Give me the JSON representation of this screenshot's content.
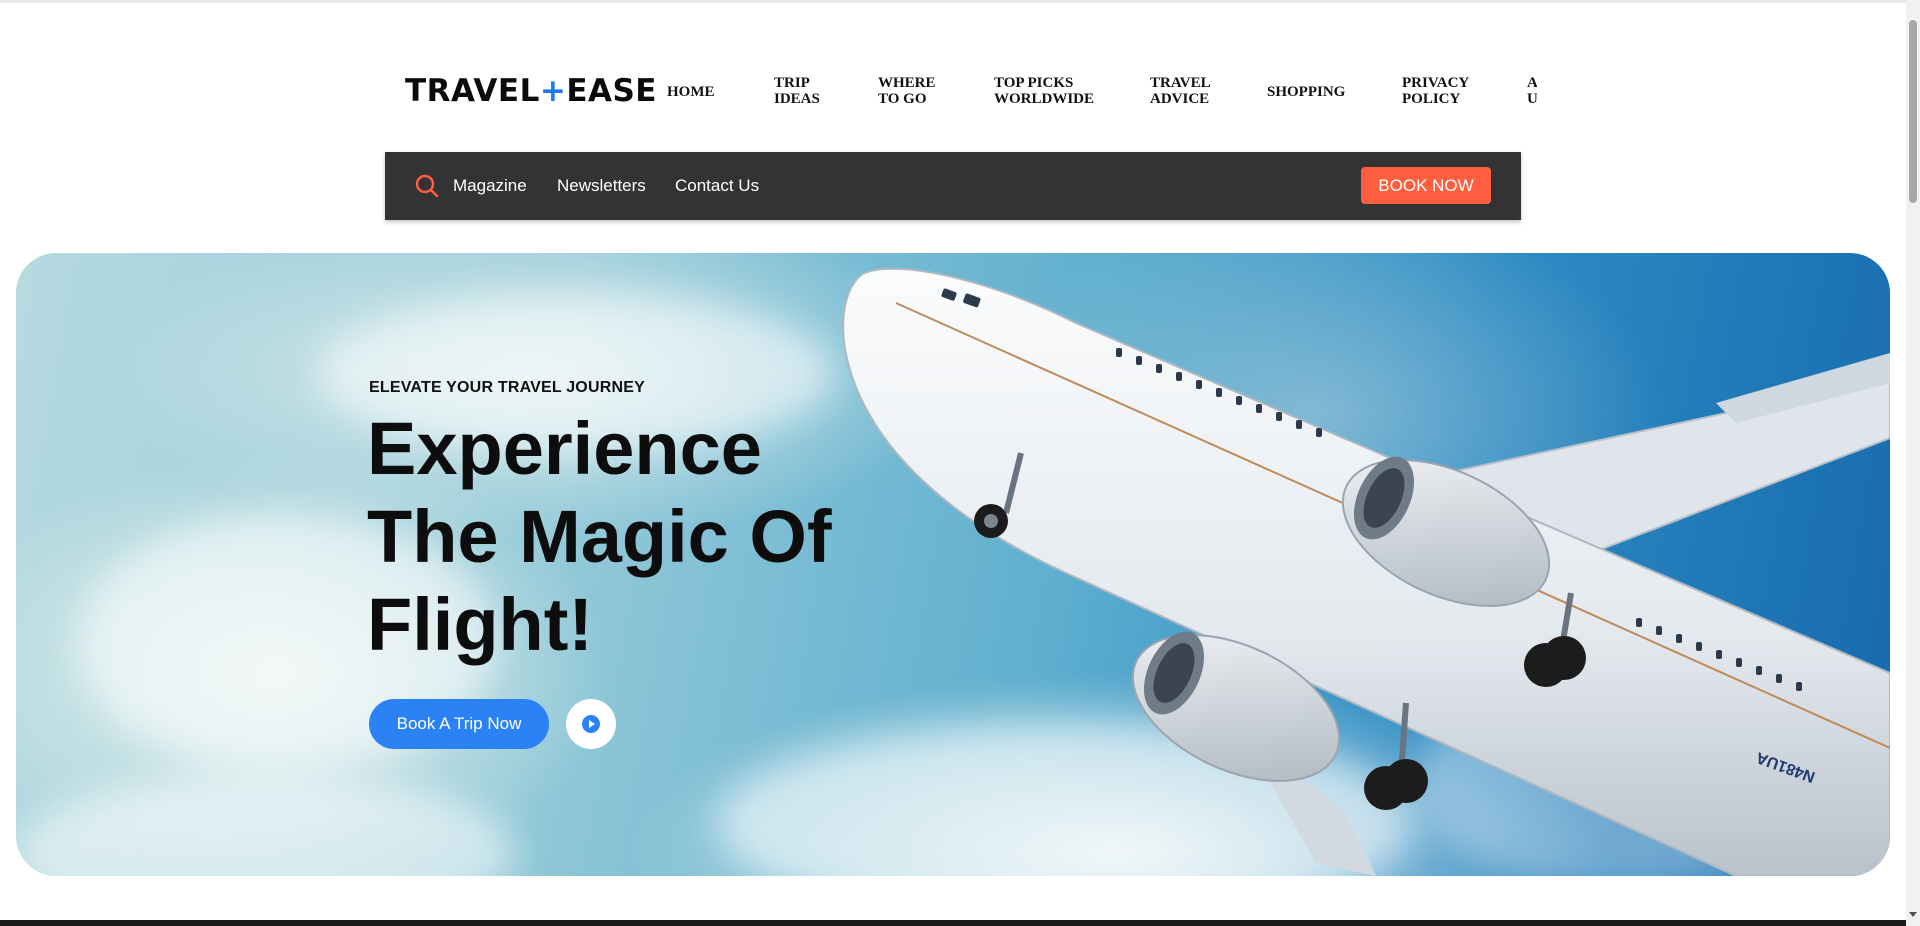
{
  "brand": {
    "logo_left": "TRAVEL",
    "logo_plus": "+",
    "logo_right": "EASE",
    "accent_color": "#1f78f0"
  },
  "nav": {
    "items": [
      {
        "line1": "HOME",
        "line2": ""
      },
      {
        "line1": "TRIP",
        "line2": "IDEAS"
      },
      {
        "line1": "WHERE",
        "line2": "TO GO"
      },
      {
        "line1": "TOP PICKS",
        "line2": "WORLDWIDE"
      },
      {
        "line1": "TRAVEL",
        "line2": "ADVICE"
      },
      {
        "line1": "SHOPPING",
        "line2": ""
      },
      {
        "line1": "PRIVACY",
        "line2": "POLICY"
      },
      {
        "line1": "A",
        "line2": "U"
      }
    ]
  },
  "subbar": {
    "search_icon": "search-icon",
    "links": [
      "Magazine",
      "Newsletters",
      "Contact Us"
    ],
    "book_now_label": "BOOK NOW",
    "background_color": "#333333",
    "button_color": "#ff5f3f"
  },
  "hero": {
    "eyebrow": "ELEVATE YOUR TRAVEL JOURNEY",
    "headline_lines": [
      "Experience",
      "The Magic Of",
      "Flight!"
    ],
    "cta_label": "Book A Trip Now",
    "play_icon": "play-icon",
    "cta_color": "#2a82f4",
    "plane_registration": "N481UA"
  }
}
